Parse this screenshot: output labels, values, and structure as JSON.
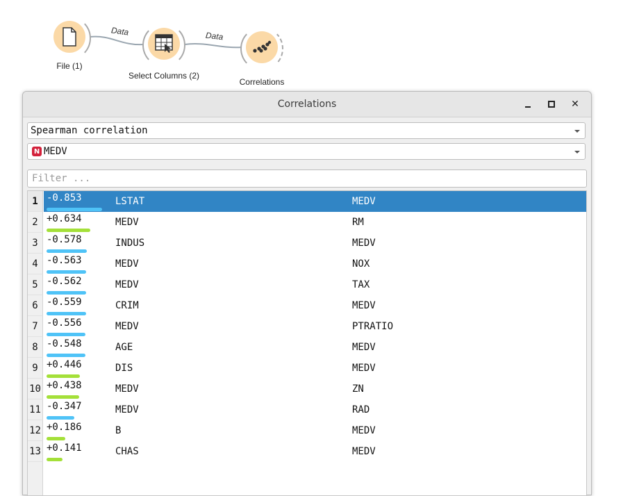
{
  "workflow": {
    "nodes": [
      {
        "label": "File (1)",
        "icon": "document-icon"
      },
      {
        "label": "Select Columns (2)",
        "icon": "select-columns-icon"
      },
      {
        "label": "Correlations",
        "icon": "scatter-dots-icon"
      }
    ],
    "links": [
      {
        "label": "Data"
      },
      {
        "label": "Data"
      }
    ]
  },
  "window": {
    "title": "Correlations",
    "buttons": {
      "minimize": "minimize-icon",
      "maximize": "maximize-icon",
      "close": "close-icon"
    }
  },
  "controls": {
    "method": "Spearman correlation",
    "target_feature": "MEDV",
    "target_feature_badge": "N",
    "filter_placeholder": "Filter ..."
  },
  "colors": {
    "selection": "#3185c5",
    "negative_bar": "#4fc3f7",
    "positive_bar": "#a4e039",
    "numeric_badge": "#d3213b"
  },
  "table": {
    "selected_row": 1,
    "rows": [
      {
        "index": "1",
        "value": "-0.853",
        "corr": -0.853,
        "var1": "LSTAT",
        "var2": "MEDV"
      },
      {
        "index": "2",
        "value": "+0.634",
        "corr": 0.634,
        "var1": "MEDV",
        "var2": "RM"
      },
      {
        "index": "3",
        "value": "-0.578",
        "corr": -0.578,
        "var1": "INDUS",
        "var2": "MEDV"
      },
      {
        "index": "4",
        "value": "-0.563",
        "corr": -0.563,
        "var1": "MEDV",
        "var2": "NOX"
      },
      {
        "index": "5",
        "value": "-0.562",
        "corr": -0.562,
        "var1": "MEDV",
        "var2": "TAX"
      },
      {
        "index": "6",
        "value": "-0.559",
        "corr": -0.559,
        "var1": "CRIM",
        "var2": "MEDV"
      },
      {
        "index": "7",
        "value": "-0.556",
        "corr": -0.556,
        "var1": "MEDV",
        "var2": "PTRATIO"
      },
      {
        "index": "8",
        "value": "-0.548",
        "corr": -0.548,
        "var1": "AGE",
        "var2": "MEDV"
      },
      {
        "index": "9",
        "value": "+0.446",
        "corr": 0.446,
        "var1": "DIS",
        "var2": "MEDV"
      },
      {
        "index": "10",
        "value": "+0.438",
        "corr": 0.438,
        "var1": "MEDV",
        "var2": "ZN"
      },
      {
        "index": "11",
        "value": "-0.347",
        "corr": -0.347,
        "var1": "MEDV",
        "var2": "RAD"
      },
      {
        "index": "12",
        "value": "+0.186",
        "corr": 0.186,
        "var1": "B",
        "var2": "MEDV"
      },
      {
        "index": "13",
        "value": "+0.141",
        "corr": 0.141,
        "var1": "CHAS",
        "var2": "MEDV"
      }
    ]
  }
}
